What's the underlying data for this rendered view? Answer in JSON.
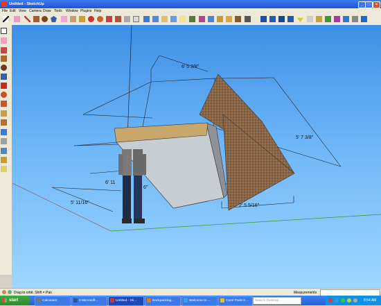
{
  "window": {
    "title": "Untitled - SketchUp",
    "min": "_",
    "max": "□",
    "close": "×"
  },
  "menu": [
    "File",
    "Edit",
    "View",
    "Camera",
    "Draw",
    "Tools",
    "Window",
    "Plugins",
    "Help"
  ],
  "viewport": {
    "dimensions": {
      "top": "6' 5 3/8\"",
      "right": "5' 7 3/8\"",
      "bottom": "2' 5 5/16\"",
      "left": "5' 11/16\"",
      "front": "6' 11",
      "front_small": "6\""
    }
  },
  "status": {
    "hint": "Drag to orbit.  Shift = Pan",
    "measurements_label": "Measurements",
    "measurements_value": ""
  },
  "taskbar": {
    "start": "start",
    "tasks": [
      {
        "label": "Calculator",
        "color": "#777777",
        "active": false
      },
      {
        "label": "3 Microsoft...",
        "color": "#2b5797",
        "active": false
      },
      {
        "label": "Untitled - Sk...",
        "color": "#c8382b",
        "active": true
      },
      {
        "label": "Backpacking...",
        "color": "#e07b1a",
        "active": false
      },
      {
        "label": "Welcome to ...",
        "color": "#3aa0e8",
        "active": false
      },
      {
        "label": "Corel Paint S...",
        "color": "#e8c12a",
        "active": false
      }
    ],
    "search_placeholder": "Search Desktop",
    "clock": "8:54 AM"
  }
}
